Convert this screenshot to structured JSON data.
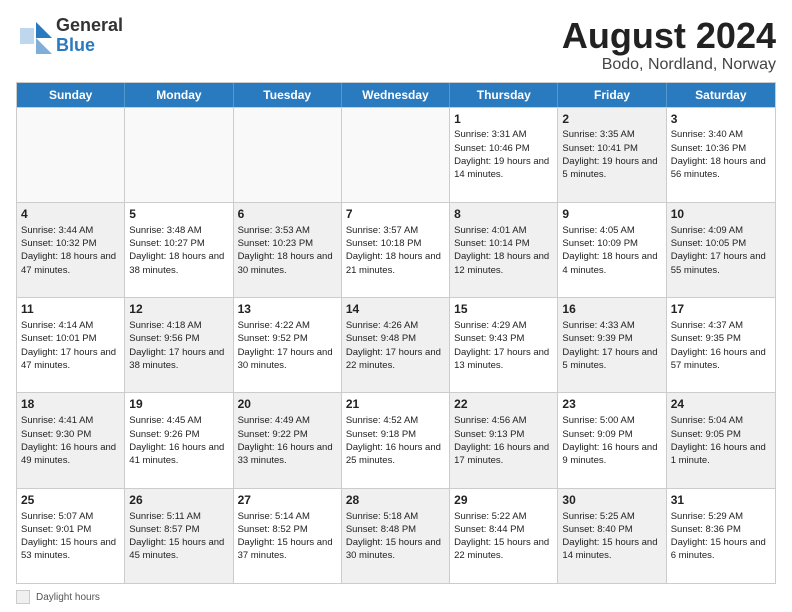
{
  "header": {
    "logo_general": "General",
    "logo_blue": "Blue",
    "title": "August 2024",
    "location": "Bodo, Nordland, Norway"
  },
  "calendar": {
    "days_of_week": [
      "Sunday",
      "Monday",
      "Tuesday",
      "Wednesday",
      "Thursday",
      "Friday",
      "Saturday"
    ],
    "weeks": [
      [
        {
          "day": "",
          "empty": true
        },
        {
          "day": "",
          "empty": true
        },
        {
          "day": "",
          "empty": true
        },
        {
          "day": "",
          "empty": true
        },
        {
          "day": "1",
          "sunrise": "Sunrise: 3:31 AM",
          "sunset": "Sunset: 10:46 PM",
          "daylight": "Daylight: 19 hours and 14 minutes.",
          "shaded": false
        },
        {
          "day": "2",
          "sunrise": "Sunrise: 3:35 AM",
          "sunset": "Sunset: 10:41 PM",
          "daylight": "Daylight: 19 hours and 5 minutes.",
          "shaded": true
        },
        {
          "day": "3",
          "sunrise": "Sunrise: 3:40 AM",
          "sunset": "Sunset: 10:36 PM",
          "daylight": "Daylight: 18 hours and 56 minutes.",
          "shaded": false
        }
      ],
      [
        {
          "day": "4",
          "sunrise": "Sunrise: 3:44 AM",
          "sunset": "Sunset: 10:32 PM",
          "daylight": "Daylight: 18 hours and 47 minutes.",
          "shaded": true
        },
        {
          "day": "5",
          "sunrise": "Sunrise: 3:48 AM",
          "sunset": "Sunset: 10:27 PM",
          "daylight": "Daylight: 18 hours and 38 minutes.",
          "shaded": false
        },
        {
          "day": "6",
          "sunrise": "Sunrise: 3:53 AM",
          "sunset": "Sunset: 10:23 PM",
          "daylight": "Daylight: 18 hours and 30 minutes.",
          "shaded": true
        },
        {
          "day": "7",
          "sunrise": "Sunrise: 3:57 AM",
          "sunset": "Sunset: 10:18 PM",
          "daylight": "Daylight: 18 hours and 21 minutes.",
          "shaded": false
        },
        {
          "day": "8",
          "sunrise": "Sunrise: 4:01 AM",
          "sunset": "Sunset: 10:14 PM",
          "daylight": "Daylight: 18 hours and 12 minutes.",
          "shaded": true
        },
        {
          "day": "9",
          "sunrise": "Sunrise: 4:05 AM",
          "sunset": "Sunset: 10:09 PM",
          "daylight": "Daylight: 18 hours and 4 minutes.",
          "shaded": false
        },
        {
          "day": "10",
          "sunrise": "Sunrise: 4:09 AM",
          "sunset": "Sunset: 10:05 PM",
          "daylight": "Daylight: 17 hours and 55 minutes.",
          "shaded": true
        }
      ],
      [
        {
          "day": "11",
          "sunrise": "Sunrise: 4:14 AM",
          "sunset": "Sunset: 10:01 PM",
          "daylight": "Daylight: 17 hours and 47 minutes.",
          "shaded": false
        },
        {
          "day": "12",
          "sunrise": "Sunrise: 4:18 AM",
          "sunset": "Sunset: 9:56 PM",
          "daylight": "Daylight: 17 hours and 38 minutes.",
          "shaded": true
        },
        {
          "day": "13",
          "sunrise": "Sunrise: 4:22 AM",
          "sunset": "Sunset: 9:52 PM",
          "daylight": "Daylight: 17 hours and 30 minutes.",
          "shaded": false
        },
        {
          "day": "14",
          "sunrise": "Sunrise: 4:26 AM",
          "sunset": "Sunset: 9:48 PM",
          "daylight": "Daylight: 17 hours and 22 minutes.",
          "shaded": true
        },
        {
          "day": "15",
          "sunrise": "Sunrise: 4:29 AM",
          "sunset": "Sunset: 9:43 PM",
          "daylight": "Daylight: 17 hours and 13 minutes.",
          "shaded": false
        },
        {
          "day": "16",
          "sunrise": "Sunrise: 4:33 AM",
          "sunset": "Sunset: 9:39 PM",
          "daylight": "Daylight: 17 hours and 5 minutes.",
          "shaded": true
        },
        {
          "day": "17",
          "sunrise": "Sunrise: 4:37 AM",
          "sunset": "Sunset: 9:35 PM",
          "daylight": "Daylight: 16 hours and 57 minutes.",
          "shaded": false
        }
      ],
      [
        {
          "day": "18",
          "sunrise": "Sunrise: 4:41 AM",
          "sunset": "Sunset: 9:30 PM",
          "daylight": "Daylight: 16 hours and 49 minutes.",
          "shaded": true
        },
        {
          "day": "19",
          "sunrise": "Sunrise: 4:45 AM",
          "sunset": "Sunset: 9:26 PM",
          "daylight": "Daylight: 16 hours and 41 minutes.",
          "shaded": false
        },
        {
          "day": "20",
          "sunrise": "Sunrise: 4:49 AM",
          "sunset": "Sunset: 9:22 PM",
          "daylight": "Daylight: 16 hours and 33 minutes.",
          "shaded": true
        },
        {
          "day": "21",
          "sunrise": "Sunrise: 4:52 AM",
          "sunset": "Sunset: 9:18 PM",
          "daylight": "Daylight: 16 hours and 25 minutes.",
          "shaded": false
        },
        {
          "day": "22",
          "sunrise": "Sunrise: 4:56 AM",
          "sunset": "Sunset: 9:13 PM",
          "daylight": "Daylight: 16 hours and 17 minutes.",
          "shaded": true
        },
        {
          "day": "23",
          "sunrise": "Sunrise: 5:00 AM",
          "sunset": "Sunset: 9:09 PM",
          "daylight": "Daylight: 16 hours and 9 minutes.",
          "shaded": false
        },
        {
          "day": "24",
          "sunrise": "Sunrise: 5:04 AM",
          "sunset": "Sunset: 9:05 PM",
          "daylight": "Daylight: 16 hours and 1 minute.",
          "shaded": true
        }
      ],
      [
        {
          "day": "25",
          "sunrise": "Sunrise: 5:07 AM",
          "sunset": "Sunset: 9:01 PM",
          "daylight": "Daylight: 15 hours and 53 minutes.",
          "shaded": false
        },
        {
          "day": "26",
          "sunrise": "Sunrise: 5:11 AM",
          "sunset": "Sunset: 8:57 PM",
          "daylight": "Daylight: 15 hours and 45 minutes.",
          "shaded": true
        },
        {
          "day": "27",
          "sunrise": "Sunrise: 5:14 AM",
          "sunset": "Sunset: 8:52 PM",
          "daylight": "Daylight: 15 hours and 37 minutes.",
          "shaded": false
        },
        {
          "day": "28",
          "sunrise": "Sunrise: 5:18 AM",
          "sunset": "Sunset: 8:48 PM",
          "daylight": "Daylight: 15 hours and 30 minutes.",
          "shaded": true
        },
        {
          "day": "29",
          "sunrise": "Sunrise: 5:22 AM",
          "sunset": "Sunset: 8:44 PM",
          "daylight": "Daylight: 15 hours and 22 minutes.",
          "shaded": false
        },
        {
          "day": "30",
          "sunrise": "Sunrise: 5:25 AM",
          "sunset": "Sunset: 8:40 PM",
          "daylight": "Daylight: 15 hours and 14 minutes.",
          "shaded": true
        },
        {
          "day": "31",
          "sunrise": "Sunrise: 5:29 AM",
          "sunset": "Sunset: 8:36 PM",
          "daylight": "Daylight: 15 hours and 6 minutes.",
          "shaded": false
        }
      ]
    ]
  },
  "legend": {
    "shaded_label": "Daylight hours"
  }
}
